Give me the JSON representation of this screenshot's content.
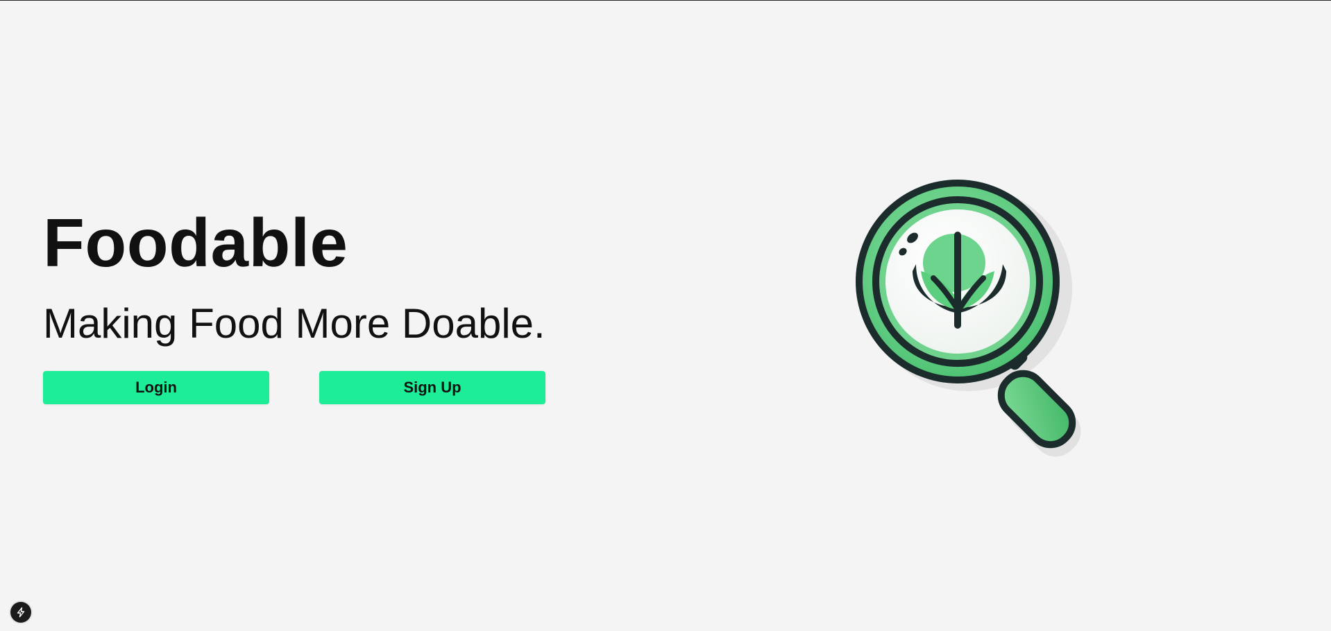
{
  "hero": {
    "title": "Foodable",
    "tagline": "Making Food More Doable."
  },
  "actions": {
    "login_label": "Login",
    "signup_label": "Sign Up"
  },
  "illustration": {
    "icon": "magnifying-glass-leaf-icon"
  },
  "devtools": {
    "icon": "lightning-bolt-icon"
  },
  "colors": {
    "accent": "#1ded97",
    "background": "#f4f4f4",
    "text": "#111111",
    "illustration_green": "#5ccf7f",
    "illustration_outline": "#1c2b2b"
  }
}
